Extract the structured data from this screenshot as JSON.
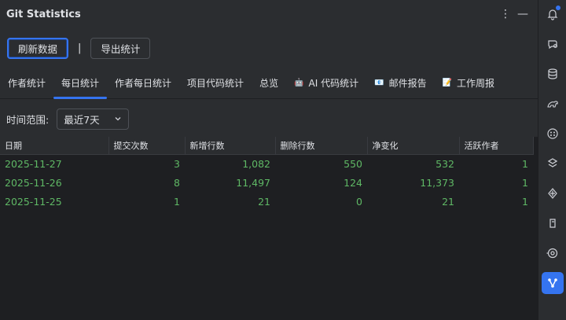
{
  "window": {
    "title": "Git Statistics"
  },
  "toolbar": {
    "refresh_label": "刷新数据",
    "separator": "|",
    "export_label": "导出统计"
  },
  "tabs": [
    {
      "label": "作者统计",
      "emoji": ""
    },
    {
      "label": "每日统计",
      "emoji": "",
      "active": true
    },
    {
      "label": "作者每日统计",
      "emoji": ""
    },
    {
      "label": "项目代码统计",
      "emoji": ""
    },
    {
      "label": "总览",
      "emoji": ""
    },
    {
      "label": "AI 代码统计",
      "emoji": "🤖"
    },
    {
      "label": "邮件报告",
      "emoji": "📧"
    },
    {
      "label": "工作周报",
      "emoji": "📝"
    }
  ],
  "filter": {
    "label": "时间范围:",
    "value": "最近7天"
  },
  "table": {
    "columns": [
      "日期",
      "提交次数",
      "新增行数",
      "删除行数",
      "净变化",
      "活跃作者"
    ],
    "rows": [
      [
        "2025-11-27",
        "3",
        "1,082",
        "550",
        "532",
        "1"
      ],
      [
        "2025-11-26",
        "8",
        "11,497",
        "124",
        "11,373",
        "1"
      ],
      [
        "2025-11-25",
        "1",
        "21",
        "0",
        "21",
        "1"
      ]
    ]
  },
  "colors": {
    "accent": "#3574f0",
    "positive_text": "#5fb865",
    "panel_bg": "#2b2d30",
    "table_bg": "#1e1f22"
  },
  "rightbar_icons": [
    "notifications-icon",
    "ai-chat-icon",
    "database-icon",
    "gradle-icon",
    "plugin-icon",
    "docker-icon",
    "copilot-icon",
    "java-icon",
    "services-icon",
    "git-statistics-icon"
  ]
}
